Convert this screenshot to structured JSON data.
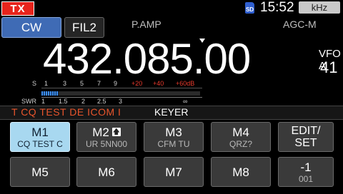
{
  "status": {
    "tx_label": "TX",
    "sd_label": "SD",
    "time": "15:52",
    "unit": "kHz"
  },
  "controls": {
    "mode": "CW",
    "filter": "FIL2",
    "preamp": "P.AMP",
    "agc": "AGC-M"
  },
  "frequency": {
    "value": "432.085.00",
    "vfo": "VFO A",
    "channel": "41"
  },
  "meter": {
    "s_labels": [
      "S",
      "1",
      "3",
      "5",
      "7",
      "9",
      "+20",
      "+40",
      "+60dB"
    ],
    "swr_labels": [
      "SWR",
      "1",
      "1.5",
      "2",
      "2.5",
      "3",
      "∞"
    ],
    "level": 0.11,
    "colors": {
      "bar": "#3e8ff0",
      "over": "#e83a2c"
    }
  },
  "keyer": {
    "cw_text": "T CQ TEST DE ICOM I",
    "title": "KEYER"
  },
  "memory_keys": [
    {
      "label": "M1",
      "sub": "CQ TEST C",
      "active": true
    },
    {
      "label": "M2",
      "sub": "UR 5NN00",
      "icon": "up-arrow-icon",
      "icon_glyph": "🡅"
    },
    {
      "label": "M3",
      "sub": "CFM TU"
    },
    {
      "label": "M4",
      "sub": "QRZ?"
    },
    {
      "label": "EDIT/\nSET"
    },
    {
      "label": "M5"
    },
    {
      "label": "M6"
    },
    {
      "label": "M7"
    },
    {
      "label": "M8"
    },
    {
      "label": "-1",
      "sub": "001"
    }
  ]
}
